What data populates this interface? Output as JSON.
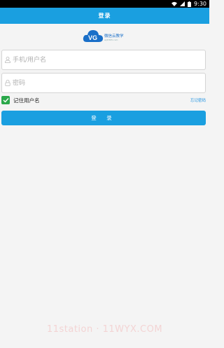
{
  "status_bar": {
    "time": "9:30"
  },
  "header": {
    "title": "登录"
  },
  "logo": {
    "name": "微信云教学",
    "subtitle": "wjdt365.com"
  },
  "form": {
    "username_placeholder": "手机/用户名",
    "username_value": "",
    "password_placeholder": "密码",
    "password_value": "",
    "remember_label": "记住用户名",
    "remember_checked": true,
    "forgot_label": "忘记密码",
    "login_label": "登 录"
  },
  "watermark": {
    "text": "11station · 11WYX.COM"
  },
  "colors": {
    "primary": "#1a9fe0",
    "checkbox": "#2aa84a",
    "background": "#f4f4f4"
  }
}
